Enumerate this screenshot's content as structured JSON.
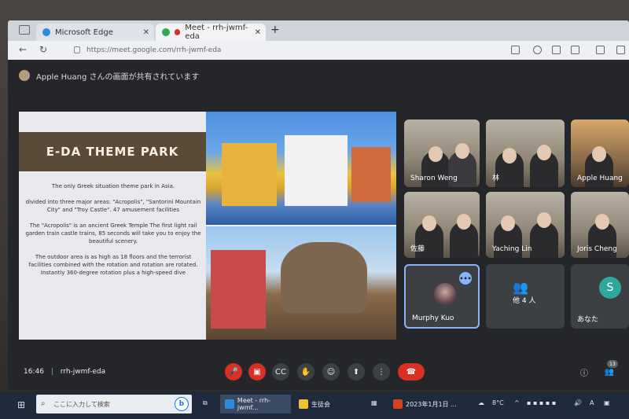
{
  "browser": {
    "tabs": [
      {
        "label": "Microsoft Edge"
      },
      {
        "label": "Meet - rrh-jwmf-eda"
      }
    ],
    "url": "https://meet.google.com/rrh-jwmf-eda"
  },
  "meet": {
    "share_banner": "Apple Huang さんの画面が共有されています",
    "slide": {
      "title": "E-DA THEME PARK",
      "p1": "The only Greek situation theme park in Asia.",
      "p2": "divided into three major areas: \"Acropolis\", \"Santorini Mountain City\" and \"Troy Castle\". 47 amusement facilities",
      "p3": "The \"Acropolis\" is an ancient Greek Temple The first light rail garden train castle trains, 85 seconds will take you to enjoy the beautiful scenery.",
      "p4": "The outdoor area is as high as 18 floors and the terrorist facilities combined with the rotation and rotation are rotated. Instantly 360-degree rotation plus a high-speed dive"
    },
    "participants": [
      {
        "name": "Sharon Weng"
      },
      {
        "name": "林"
      },
      {
        "name": "Apple Huang"
      },
      {
        "name": "佐藤"
      },
      {
        "name": "Yaching Lin"
      },
      {
        "name": "Joris Cheng"
      },
      {
        "name": "Murphy Kuo"
      },
      {
        "name": "他 4 人"
      },
      {
        "name": "あなた"
      }
    ],
    "letter_avatar": "S",
    "time": "16:46",
    "meeting_code": "rrh-jwmf-eda",
    "participant_count": "13"
  },
  "taskbar": {
    "search_placeholder": "ここに入力して検索",
    "apps": [
      {
        "label": "Meet - rrh-jwmf..."
      },
      {
        "label": "生徒会"
      },
      {
        "label": "2023年1月1日 ..."
      }
    ],
    "temperature": "8°C"
  },
  "colors": {
    "accent": "#8ab4f8",
    "danger": "#d93025",
    "slide_title_bg": "#5a4a38"
  }
}
